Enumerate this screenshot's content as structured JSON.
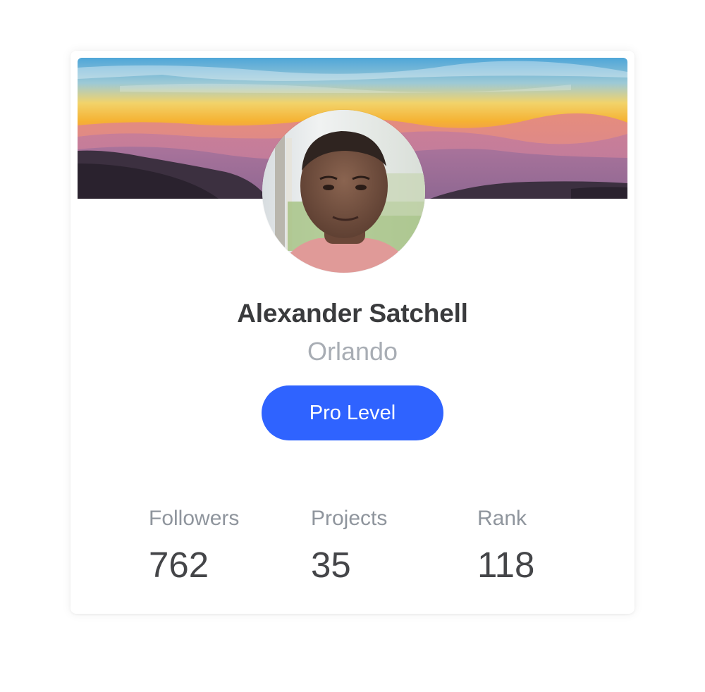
{
  "profile": {
    "name": "Alexander Satchell",
    "location": "Orlando",
    "level_button": "Pro Level"
  },
  "stats": [
    {
      "label": "Followers",
      "value": "762"
    },
    {
      "label": "Projects",
      "value": "35"
    },
    {
      "label": "Rank",
      "value": "118"
    }
  ],
  "colors": {
    "accent": "#2f63ff",
    "name_text": "#3a3b3d",
    "muted_text": "#a8adb4",
    "stat_label": "#8f959d",
    "stat_value": "#444548"
  },
  "icons": {
    "cover": "sunset-mountains-image",
    "avatar": "profile-photo"
  }
}
